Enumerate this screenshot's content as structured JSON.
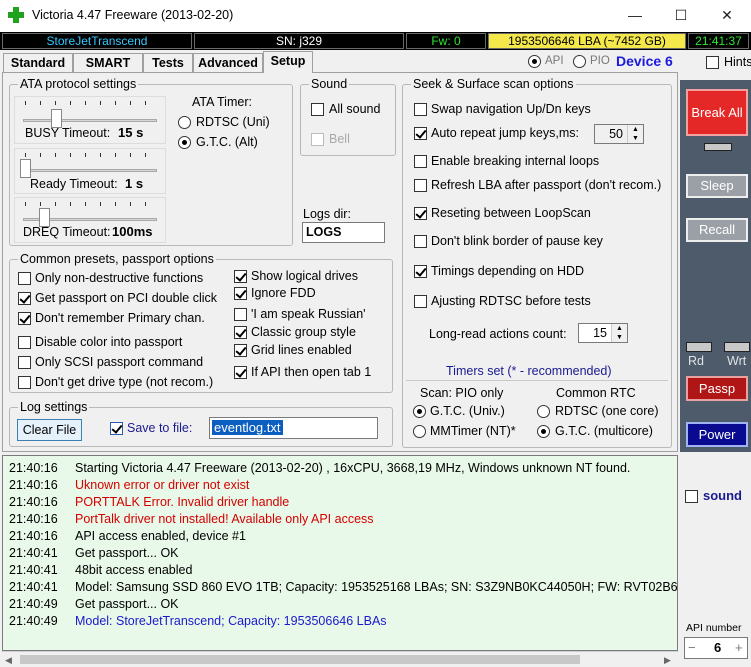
{
  "window": {
    "title": "Victoria 4.47  Freeware (2013-02-20)",
    "minimize": "—",
    "maximize": "☐",
    "close": "✕",
    "app_icon": "green-cross-icon"
  },
  "status": {
    "device": "StoreJetTranscend",
    "serial": "SN: j329",
    "fw": "Fw: 0",
    "lba": "1953506646 LBA (~7452 GB)",
    "time": "21:41:37"
  },
  "tabs": [
    "Standard",
    "SMART",
    "Tests",
    "Advanced",
    "Setup"
  ],
  "active_tab": "Setup",
  "mode": {
    "api": "API",
    "pio": "PIO",
    "device": "Device 6"
  },
  "hints": "Hints",
  "ata": {
    "title": "ATA protocol settings",
    "busy_label": "BUSY Timeout:",
    "busy_value": "15 s",
    "ready_label": "Ready Timeout:",
    "ready_value": "1 s",
    "dreq_label": "DREQ Timeout:",
    "dreq_value": "100ms",
    "timer_title": "ATA Timer:",
    "rdtsc": "RDTSC (Uni)",
    "gtc": "G.T.C.  (Alt)"
  },
  "sound": {
    "title": "Sound",
    "all_sound": "All sound",
    "bell": "Bell"
  },
  "logsdir": {
    "label": "Logs dir:",
    "value": "LOGS"
  },
  "presets": {
    "title": "Common presets, passport options",
    "left": [
      {
        "label": "Only non-destructive functions",
        "checked": false
      },
      {
        "label": "Get passport on PCI double click",
        "checked": true
      },
      {
        "label": "Don't remember Primary chan.",
        "checked": true
      },
      {
        "label": "Disable color into passport",
        "checked": false
      },
      {
        "label": "Only SCSI passport command",
        "checked": false
      },
      {
        "label": "Don't get drive type (not recom.)",
        "checked": false
      }
    ],
    "right": [
      {
        "label": "Show logical drives",
        "checked": true
      },
      {
        "label": "Ignore FDD",
        "checked": true
      },
      {
        "label": "'I am speak Russian'",
        "checked": false
      },
      {
        "label": "Classic group style",
        "checked": true
      },
      {
        "label": "Grid lines enabled",
        "checked": true
      },
      {
        "label": "If API then open tab 1",
        "checked": true
      }
    ]
  },
  "logsettings": {
    "title": "Log settings",
    "clear": "Clear File",
    "save_label": "Save to file:",
    "file": "eventlog.txt"
  },
  "seek": {
    "title": "Seek & Surface scan options",
    "options": [
      {
        "label": "Swap navigation Up/Dn keys",
        "checked": false
      },
      {
        "label": "Auto repeat jump keys,ms:",
        "checked": true
      },
      {
        "label": "Enable breaking internal loops",
        "checked": false
      },
      {
        "label": "Refresh LBA after passport (don't recom.)",
        "checked": false
      },
      {
        "label": "Reseting between LoopScan",
        "checked": true
      },
      {
        "label": "Don't blink border of pause key",
        "checked": false
      },
      {
        "label": "Timings depending on HDD",
        "checked": true
      },
      {
        "label": "Ajusting RDTSC before tests",
        "checked": false
      }
    ],
    "repeat_ms": "50",
    "longread_label": "Long-read actions count:",
    "longread_value": "15",
    "timers_title": "Timers set  (* - recommended)",
    "scan_label": "Scan: PIO only",
    "rtc_label": "Common RTC",
    "gtc_univ": "G.T.C. (Univ.)",
    "mmtimer": "MMTimer (NT)*",
    "rdtsc_core": "RDTSC (one core)",
    "gtc_multi": "G.T.C.  (multicore)"
  },
  "right": {
    "break_all": "Break All",
    "sleep": "Sleep",
    "recall": "Recall",
    "rd": "Rd",
    "wrt": "Wrt",
    "passp": "Passp",
    "power": "Power",
    "sound": "sound",
    "api_number_label": "API number",
    "api_number": "6",
    "minus": "−",
    "plus": "+"
  },
  "log": [
    {
      "time": "21:40:16",
      "text": "Starting Victoria 4.47  Freeware (2013-02-20) , 16xCPU, 3668,19 MHz, Windows unknown NT found.",
      "color": "#000000"
    },
    {
      "time": "21:40:16",
      "text": "Uknown error or driver not exist",
      "color": "#d40000"
    },
    {
      "time": "21:40:16",
      "text": "PORTTALK Error. Invalid driver handle",
      "color": "#d40000"
    },
    {
      "time": "21:40:16",
      "text": "PortTalk driver not installed! Available only API access",
      "color": "#d40000"
    },
    {
      "time": "21:40:16",
      "text": "API access enabled, device #1",
      "color": "#000000"
    },
    {
      "time": "21:40:41",
      "text": "Get passport... OK",
      "color": "#000000"
    },
    {
      "time": "21:40:41",
      "text": "48bit access enabled",
      "color": "#000000"
    },
    {
      "time": "21:40:41",
      "text": "Model: Samsung SSD 860 EVO 1TB; Capacity: 1953525168 LBAs; SN: S3Z9NB0KC44050H; FW: RVT02B6",
      "color": "#000000"
    },
    {
      "time": "21:40:49",
      "text": "Get passport... OK",
      "color": "#000000"
    },
    {
      "time": "21:40:49",
      "text": "Model: StoreJetTranscend; Capacity: 1953506646 LBAs",
      "color": "#1a1acc"
    }
  ]
}
